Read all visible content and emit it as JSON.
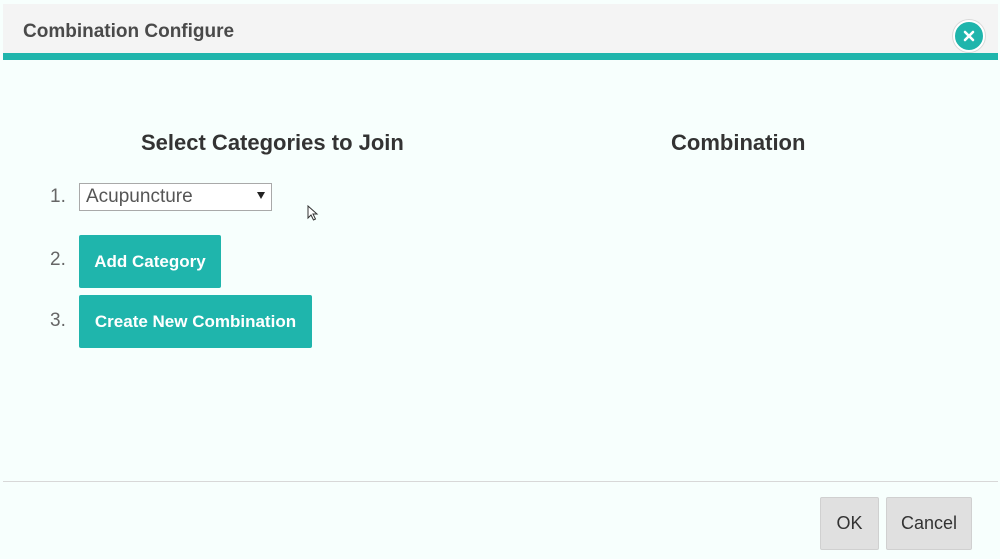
{
  "dialog": {
    "title": "Combination Configure",
    "close_icon": "close-icon"
  },
  "colors": {
    "accent": "#1fb5ac",
    "header_bg": "#f4f4f4",
    "button_grey": "#e0e0e0"
  },
  "left_panel": {
    "heading": "Select Categories to Join",
    "steps": [
      {
        "number": "1."
      },
      {
        "number": "2.",
        "button_label": "Add Category"
      },
      {
        "number": "3.",
        "button_label": "Create New Combination"
      }
    ],
    "category_select": {
      "selected": "Acupuncture",
      "icon": "dropdown-arrow-icon"
    }
  },
  "right_panel": {
    "heading": "Combination"
  },
  "footer": {
    "ok_label": "OK",
    "cancel_label": "Cancel"
  }
}
